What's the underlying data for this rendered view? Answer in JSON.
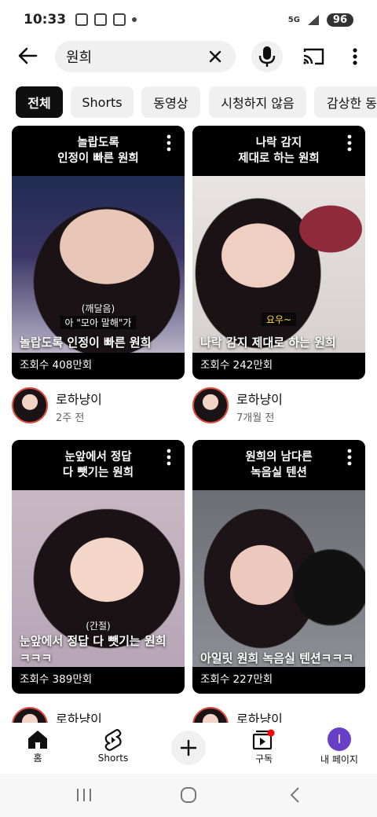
{
  "status_bar": {
    "time": "10:33",
    "signal": "5G",
    "battery": "96"
  },
  "search": {
    "query": "원희"
  },
  "chips": [
    "전체",
    "Shorts",
    "동영상",
    "시청하지 않음",
    "감상한 동"
  ],
  "shorts": [
    {
      "title_lines": [
        "놀랍도록",
        "인정이 빠른 원희"
      ],
      "sub1": "(깨달음)",
      "sub2": "아 \"모아 말해\"가",
      "caption": "놀랍도록 인정이 빠른 원희",
      "views": "조회수 408만회",
      "channel": "로하냥이",
      "age": "2주 전"
    },
    {
      "title_lines": [
        "나락 감지",
        "제대로 하는 원희"
      ],
      "sub1": "요우~",
      "sub2": "",
      "caption": "나락 감지 제대로 하는 원희",
      "views": "조회수 242만회",
      "channel": "로하냥이",
      "age": "7개월 전"
    },
    {
      "title_lines": [
        "눈앞에서 정답",
        "다 뺏기는 원희"
      ],
      "sub1": "(간절)",
      "sub2": "",
      "caption": "눈앞에서 정답 다 뺏기는 원희 ㅋㅋㅋ",
      "views": "조회수 389만회",
      "channel": "로하냥이",
      "age": ""
    },
    {
      "title_lines": [
        "원희의 남다른",
        "녹음실 텐션"
      ],
      "sub1": "",
      "sub2": "",
      "caption": "아일릿 원희 녹음실 텐션ㅋㅋㅋ",
      "views": "조회수 227만회",
      "channel": "로하냥이",
      "age": ""
    }
  ],
  "bottom_nav": {
    "home": "홈",
    "shorts": "Shorts",
    "subscriptions": "구독",
    "you": "내 페이지",
    "profile_initial": "I"
  },
  "colors": {
    "accent": "#ff0000",
    "profile": "#6a3fc8",
    "chip_active": "#0f0f0f"
  }
}
